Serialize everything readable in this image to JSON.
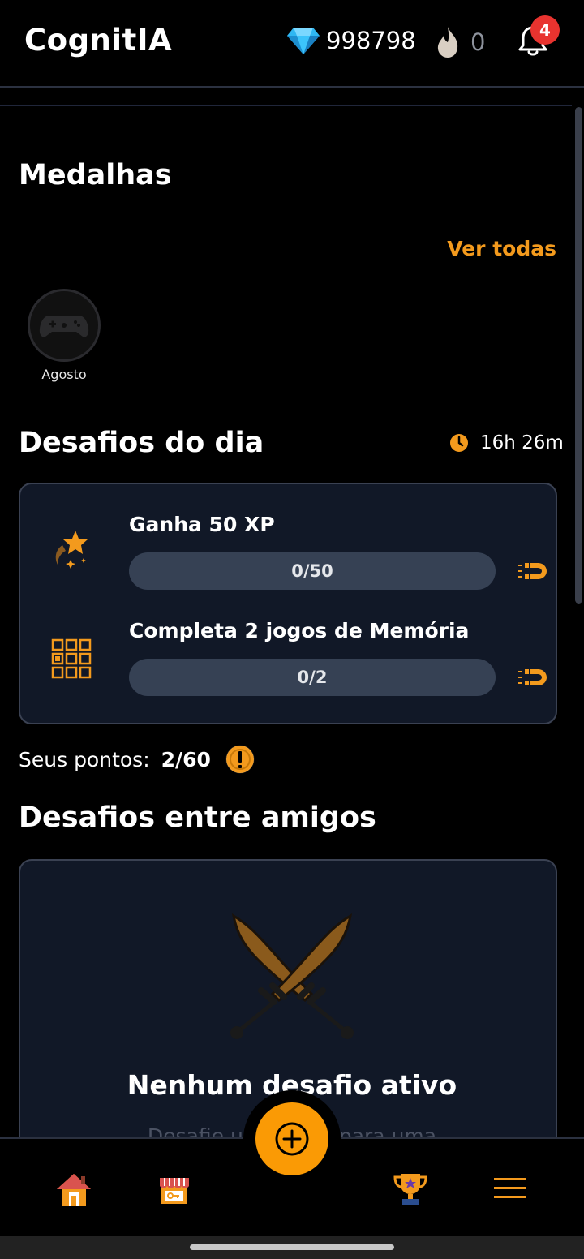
{
  "header": {
    "title": "CognitIA",
    "gems": "998798",
    "streak": "0",
    "notifications": "4"
  },
  "medals": {
    "title": "Medalhas",
    "see_all": "Ver todas",
    "items": [
      {
        "label": "Agosto",
        "icon": "gamepad-icon"
      }
    ]
  },
  "daily": {
    "title": "Desafios do dia",
    "timer": "16h 26m",
    "challenges": [
      {
        "title": "Ganha 50 XP",
        "progress": "0/50",
        "progress_fraction": 0,
        "icon": "star-xp-icon"
      },
      {
        "title": "Completa 2 jogos de Memória",
        "progress": "0/2",
        "progress_fraction": 0,
        "icon": "memory-grid-icon"
      }
    ]
  },
  "points": {
    "label": "Seus pontos:",
    "value": "2/60"
  },
  "friends": {
    "title": "Desafios entre amigos",
    "empty_title": "Nenhum desafio ativo",
    "empty_subtitle": "Desafie um amigo para uma"
  },
  "colors": {
    "accent": "#f39a1d",
    "fab": "#fa9a05",
    "card_bg": "#111827",
    "bar_bg": "#364154",
    "badge": "#e8332f"
  },
  "nav": [
    "home-icon",
    "shop-icon",
    "add-icon",
    "trophy-icon",
    "menu-icon"
  ]
}
